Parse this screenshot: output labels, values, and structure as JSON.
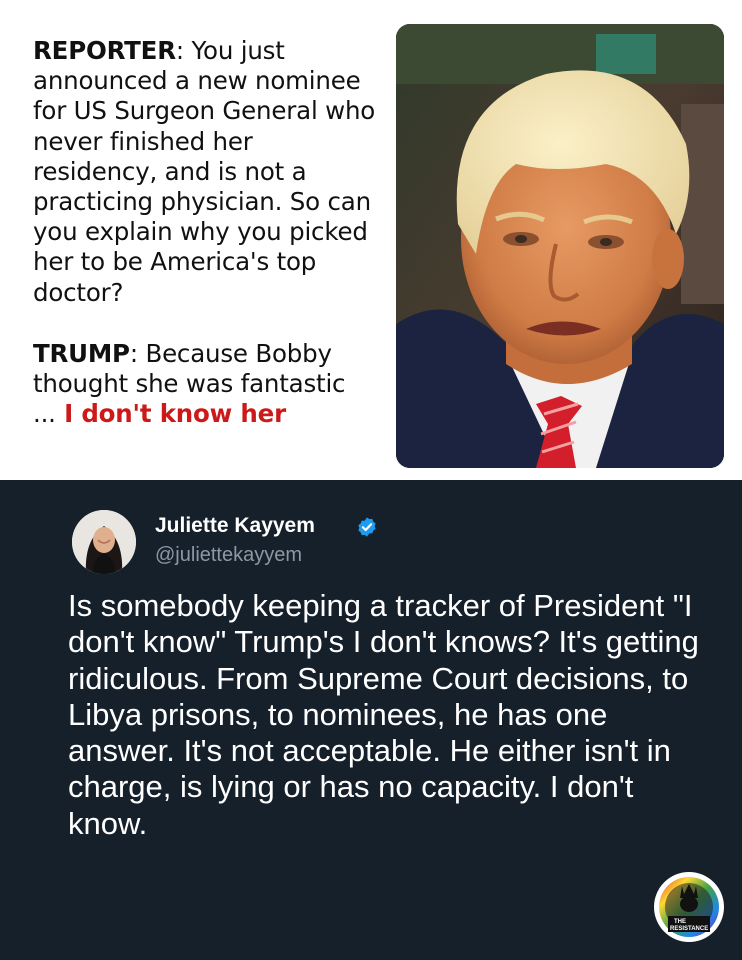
{
  "quote": {
    "reporter_label": "REPORTER",
    "reporter_text": ": You just announced a new nominee for US Surgeon General who never finished her residency, and is not a practicing physician. So can you explain why you picked her to be America's top doctor?",
    "trump_label": "TRUMP",
    "trump_text": ": Because Bobby thought she was fantastic",
    "ellipsis": "...",
    "trump_highlight": " I don't know her",
    "highlight_color": "#cc1a1a"
  },
  "tweet": {
    "display_name": "Juliette Kayyem",
    "handle": "@juliettekayyem",
    "verified": true,
    "verified_color": "#1d9bf0",
    "text": "Is somebody keeping a tracker of President \"I don't know\" Trump's I don't knows? It's getting ridiculous. From Supreme Court decisions, to Libya prisons, to nominees, he has one answer. It's not acceptable. He either isn't in charge, is lying or has no capacity. I don't know.",
    "background_color": "#16202b"
  },
  "logo": {
    "line1": "THE",
    "line2": "RESISTANCE"
  },
  "icons": {
    "verified": "verified-check-icon"
  }
}
